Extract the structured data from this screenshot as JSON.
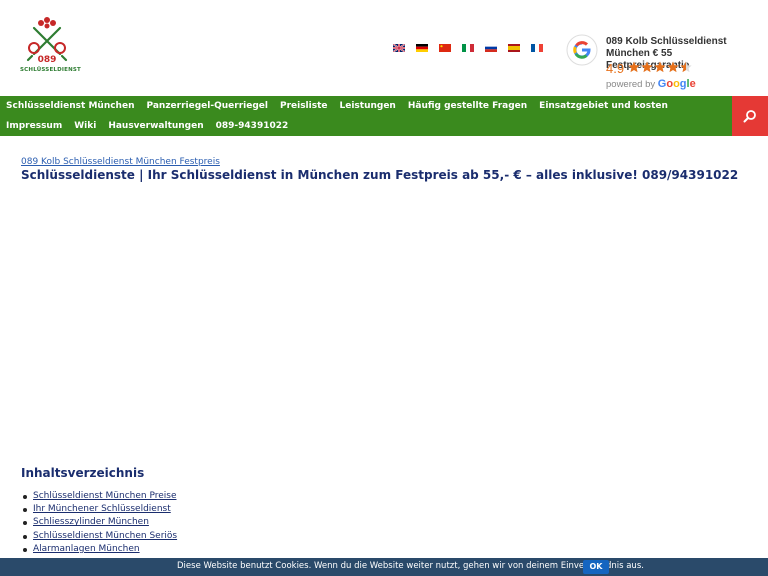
{
  "header": {
    "logo_text": "SCHLÜSSELDIENST",
    "logo_number": "089",
    "flags": [
      {
        "lang": "en",
        "icon": "uk-flag-icon"
      },
      {
        "lang": "de",
        "icon": "germany-flag-icon"
      },
      {
        "lang": "zh",
        "icon": "china-flag-icon"
      },
      {
        "lang": "it",
        "icon": "italy-flag-icon"
      },
      {
        "lang": "ru",
        "icon": "russia-flag-icon"
      },
      {
        "lang": "es",
        "icon": "spain-flag-icon"
      },
      {
        "lang": "fr",
        "icon": "france-flag-icon"
      }
    ],
    "google_badge": {
      "title": "089 Kolb Schlüsseldienst München € 55 Festpreisgarantie",
      "rating": "4.9",
      "stars": 4.5,
      "powered_prefix": "powered by ",
      "powered_brand": "Google"
    }
  },
  "nav": {
    "items": [
      "Schlüsseldienst München",
      "Panzerriegel-Querriegel",
      "Preisliste",
      "Leistungen",
      "Häufig gestellte Fragen",
      "Einsatzgebiet und kosten",
      "Impressum",
      "Wiki",
      "Hausverwaltungen",
      "089-94391022"
    ]
  },
  "main": {
    "breadcrumb": "089 Kolb Schlüsseldienst München Festpreis",
    "title": "Schlüsseldienste | Ihr Schlüsseldienst in München zum Festpreis ab 55,- € – alles inklusive! 089/94391022",
    "toc_title": "Inhaltsverzeichnis",
    "toc_items": [
      "Schlüsseldienst München Preise",
      "Ihr Münchener Schlüsseldienst",
      "Schliesszylinder München",
      "Schlüsseldienst München Seriös",
      "Alarmanlagen München"
    ]
  },
  "cookie": {
    "text": "Diese Website benutzt Cookies. Wenn du die Website weiter nutzt, gehen wir von deinem Einverständnis aus.",
    "ok_label": "OK"
  },
  "colors": {
    "nav_bg": "#3a8a1e",
    "search_bg": "#e53935",
    "title_color": "#1a2d6e",
    "cookie_bg": "#2a4a6a",
    "cookie_button": "#1565c0",
    "star_color": "#e7711b"
  }
}
